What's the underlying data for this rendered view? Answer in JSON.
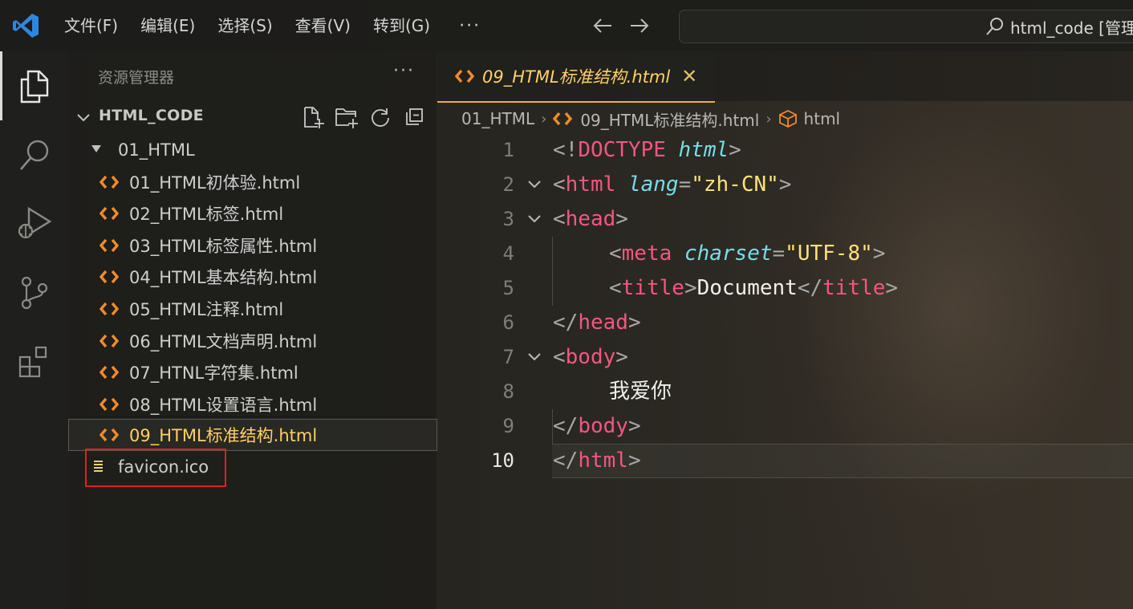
{
  "titlebar": {
    "menu": [
      "文件(F)",
      "编辑(E)",
      "选择(S)",
      "查看(V)",
      "转到(G)"
    ],
    "more": "···",
    "search_text": "html_code [管理"
  },
  "sidebar": {
    "header": "资源管理器",
    "more": "···",
    "workspace": "HTML_CODE",
    "folder": "01_HTML",
    "files": [
      "01_HTML初体验.html",
      "02_HTML标签.html",
      "03_HTML标签属性.html",
      "04_HTML基本结构.html",
      "05_HTML注释.html",
      "06_HTML文档声明.html",
      "07_HTNL字符集.html",
      "08_HTML设置语言.html",
      "09_HTML标准结构.html"
    ],
    "root_file": "favicon.ico"
  },
  "editor": {
    "tab_label": "09_HTML标准结构.html",
    "breadcrumb": {
      "folder": "01_HTML",
      "file": "09_HTML标准结构.html",
      "symbol": "html"
    },
    "line_numbers": [
      "1",
      "2",
      "3",
      "4",
      "5",
      "6",
      "7",
      "8",
      "9",
      "10"
    ],
    "code": {
      "l1": {
        "open": "<!",
        "doctype": "DOCTYPE",
        "attr": "html",
        "close": ">"
      },
      "l2": {
        "tag": "html",
        "attr": "lang",
        "value": "\"zh-CN\""
      },
      "l3": {
        "tag": "head"
      },
      "l4": {
        "tag": "meta",
        "attr": "charset",
        "value": "\"UTF-8\""
      },
      "l5": {
        "tag": "title",
        "text": "Document"
      },
      "l6": {
        "tag": "head"
      },
      "l7": {
        "tag": "body"
      },
      "l8": {
        "text": "我爱你"
      },
      "l9": {
        "tag": "body"
      },
      "l10": {
        "tag": "html"
      }
    },
    "current_line": 10
  },
  "colors": {
    "accent_tab": "#e2b340",
    "tag": "#f2577f",
    "attribute": "#78dce8",
    "string": "#ffe17a",
    "html_file_icon": "#f28c28",
    "highlight_box": "#e02020"
  }
}
